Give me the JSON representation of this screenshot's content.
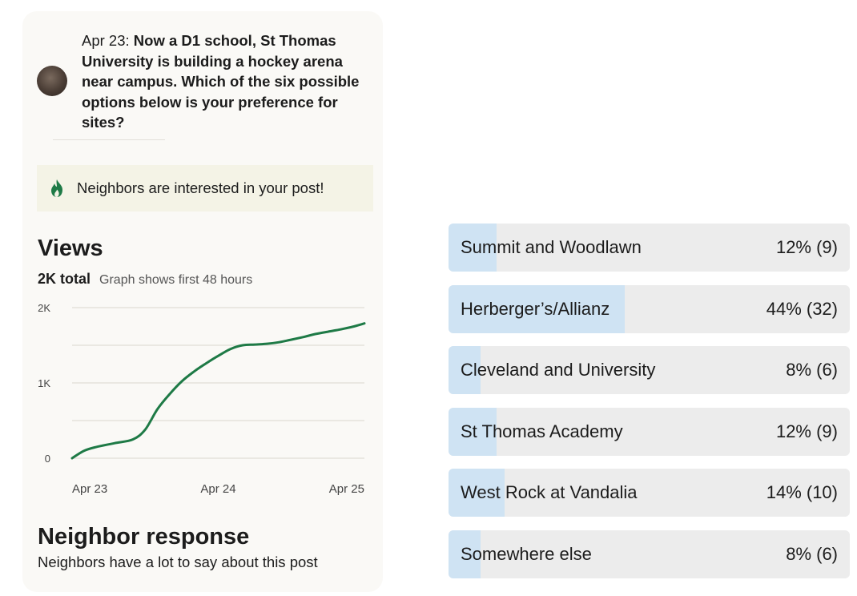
{
  "post": {
    "date": "Apr 23:",
    "body": "Now a D1 school, St Thomas University is building a hockey arena near campus. Which of the six possible options below is your preference for sites?"
  },
  "interest": {
    "text": "Neighbors are interested in your post!"
  },
  "views": {
    "title": "Views",
    "total": "2K total",
    "note": "Graph shows first 48 hours"
  },
  "chart_data": {
    "type": "line",
    "title": "Views",
    "xlabel": "",
    "ylabel": "",
    "x_ticks": [
      "Apr 23",
      "Apr 24",
      "Apr 25"
    ],
    "y_ticks": [
      "0",
      "1K",
      "2K"
    ],
    "ylim": [
      0,
      2000
    ],
    "xlim": [
      0,
      48
    ],
    "grid": true,
    "color": "#1e7a46",
    "x": [
      0,
      2,
      4,
      7,
      10,
      12,
      14,
      16,
      18,
      20,
      22,
      24,
      26,
      28,
      30,
      32,
      34,
      36,
      38,
      40,
      42,
      44,
      46,
      48
    ],
    "y": [
      0,
      100,
      150,
      200,
      250,
      380,
      650,
      850,
      1020,
      1150,
      1260,
      1360,
      1450,
      1500,
      1510,
      1520,
      1540,
      1575,
      1610,
      1650,
      1680,
      1710,
      1745,
      1790
    ]
  },
  "response": {
    "title": "Neighbor response",
    "subtitle": "Neighbors have a lot to say about this post"
  },
  "poll": {
    "options": [
      {
        "label": "Summit and Woodlawn",
        "result": "12% (9)",
        "percent": 12
      },
      {
        "label": "Herberger’s/Allianz",
        "result": "44% (32)",
        "percent": 44
      },
      {
        "label": "Cleveland and University",
        "result": "8% (6)",
        "percent": 8
      },
      {
        "label": "St Thomas Academy",
        "result": "12% (9)",
        "percent": 12
      },
      {
        "label": "West Rock at Vandalia",
        "result": "14% (10)",
        "percent": 14
      },
      {
        "label": "Somewhere else",
        "result": "8% (6)",
        "percent": 8
      }
    ]
  },
  "icons": {
    "interest": "flame-icon"
  },
  "colors": {
    "accent_green": "#1e7a46",
    "poll_fill": "#cfe3f3",
    "poll_bg": "#ececec",
    "banner": "#f4f3e6"
  }
}
